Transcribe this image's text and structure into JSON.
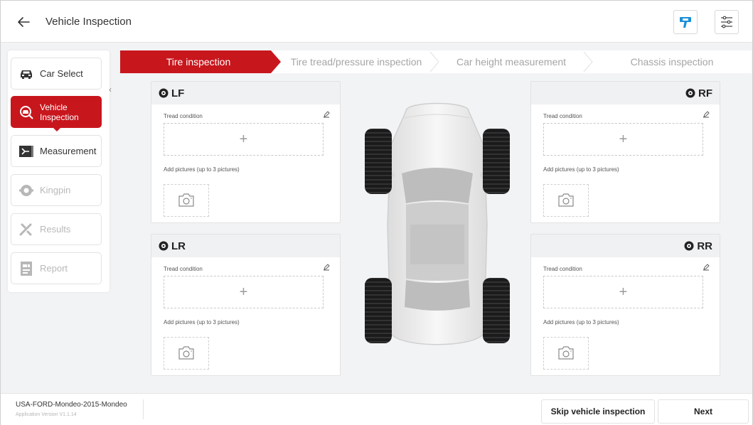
{
  "header": {
    "title": "Vehicle Inspection",
    "back_icon": "arrow-left-icon",
    "diagnostic_icon": "diagnostic-tool-icon",
    "settings_icon": "sliders-icon"
  },
  "sidebar": {
    "items": [
      {
        "label": "Car Select",
        "icon": "car-icon",
        "state": "normal"
      },
      {
        "label": "Vehicle Inspection",
        "icon": "inspection-icon",
        "state": "active"
      },
      {
        "label": "Measurement",
        "icon": "measurement-icon",
        "state": "normal"
      },
      {
        "label": "Kingpin",
        "icon": "kingpin-icon",
        "state": "disabled"
      },
      {
        "label": "Results",
        "icon": "results-icon",
        "state": "disabled"
      },
      {
        "label": "Report",
        "icon": "report-icon",
        "state": "disabled"
      }
    ],
    "collapse_glyph": "‹"
  },
  "steps": [
    {
      "label": "Tire inspection",
      "active": true
    },
    {
      "label": "Tire tread/pressure inspection",
      "active": false
    },
    {
      "label": "Car height measurement",
      "active": false
    },
    {
      "label": "Chassis inspection",
      "active": false
    }
  ],
  "tires": [
    {
      "position": "LF",
      "tread_label": "Tread condition",
      "add_glyph": "+",
      "pictures_label": "Add pictures (up to 3 pictures)"
    },
    {
      "position": "RF",
      "tread_label": "Tread condition",
      "add_glyph": "+",
      "pictures_label": "Add pictures (up to 3 pictures)"
    },
    {
      "position": "LR",
      "tread_label": "Tread condition",
      "add_glyph": "+",
      "pictures_label": "Add pictures (up to 3 pictures)"
    },
    {
      "position": "RR",
      "tread_label": "Tread condition",
      "add_glyph": "+",
      "pictures_label": "Add pictures (up to 3 pictures)"
    }
  ],
  "footer": {
    "vehicle": "USA-FORD-Mondeo-2015-Mondeo",
    "app_version": "Application Version V1.1.14",
    "skip_label": "Skip vehicle inspection",
    "next_label": "Next"
  },
  "colors": {
    "accent": "#c8161d",
    "diagnostic_icon": "#1c8fd6",
    "background": "#f2f3f5"
  }
}
